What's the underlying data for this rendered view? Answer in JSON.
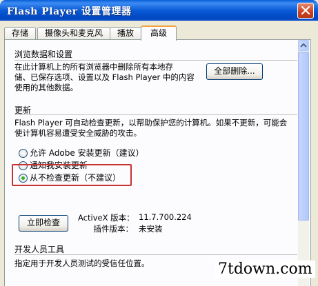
{
  "window": {
    "title": "Flash Player 设置管理器"
  },
  "tabs": [
    {
      "label": "存储"
    },
    {
      "label": "摄像头和麦克风"
    },
    {
      "label": "播放"
    },
    {
      "label": "高级"
    }
  ],
  "browse_section": {
    "title": "浏览数据和设置",
    "lines": [
      "在此计算机上的所有浏览器中删除所有本地存",
      "储、已保存选项、设置以及 Flash Player 中的内容",
      "使用的其他数据。"
    ],
    "delete_all_button": "全部删除..."
  },
  "update_section": {
    "title": "更新",
    "lines": [
      "Flash Player 可自动检查更新，以帮助保护您的计算机。如果不更新，可能会",
      "使计算机容易遭受安全威胁的攻击。"
    ],
    "options": [
      {
        "label": "允许 Adobe 安装更新（建议）",
        "checked": false
      },
      {
        "label": "通知我安装更新",
        "checked": false
      },
      {
        "label": "从不检查更新（不建议）",
        "checked": true
      }
    ],
    "check_now_button": "立即检查",
    "activex_label": "ActiveX 版本：",
    "activex_value": "11.7.700.224",
    "plugin_label": "插件版本：",
    "plugin_value": "未安装"
  },
  "dev_section": {
    "title": "开发人员工具",
    "line": "指定用于开发人员测试的受信任位置。"
  },
  "watermark": "7tdown.com"
}
